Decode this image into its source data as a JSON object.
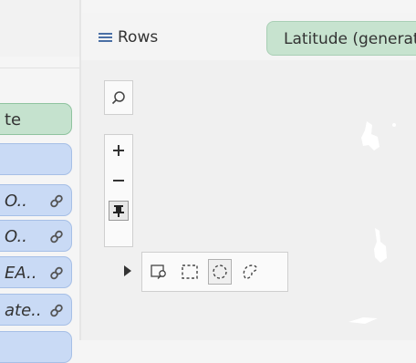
{
  "header": {
    "rows_label": "Rows",
    "rows_pill": "Latitude (generated)"
  },
  "fields": [
    {
      "text": "te",
      "color": "green",
      "linked": false
    },
    {
      "text": "",
      "color": "blue",
      "linked": false
    },
    {
      "text": "O..",
      "color": "blue",
      "linked": true
    },
    {
      "text": "O..",
      "color": "blue",
      "linked": true
    },
    {
      "text": "EA..",
      "color": "blue",
      "linked": true
    },
    {
      "text": "ate..",
      "color": "blue",
      "linked": true
    },
    {
      "text": "",
      "color": "blue",
      "linked": false
    }
  ],
  "map_controls": {
    "search": "search-icon",
    "zoom_in": "plus-icon",
    "zoom_out": "minus-icon",
    "pin": "pin-icon",
    "expand": "triangle-right-icon",
    "selection_tools": [
      "radial-select-icon",
      "rectangle-select-icon",
      "lasso-select-icon",
      "freeform-select-icon"
    ],
    "active_tool": "lasso-select-icon"
  },
  "colors": {
    "green_pill": "#c5e2ce",
    "blue_pill": "#c9daf5",
    "rows_icon": "#4a6fa5"
  }
}
